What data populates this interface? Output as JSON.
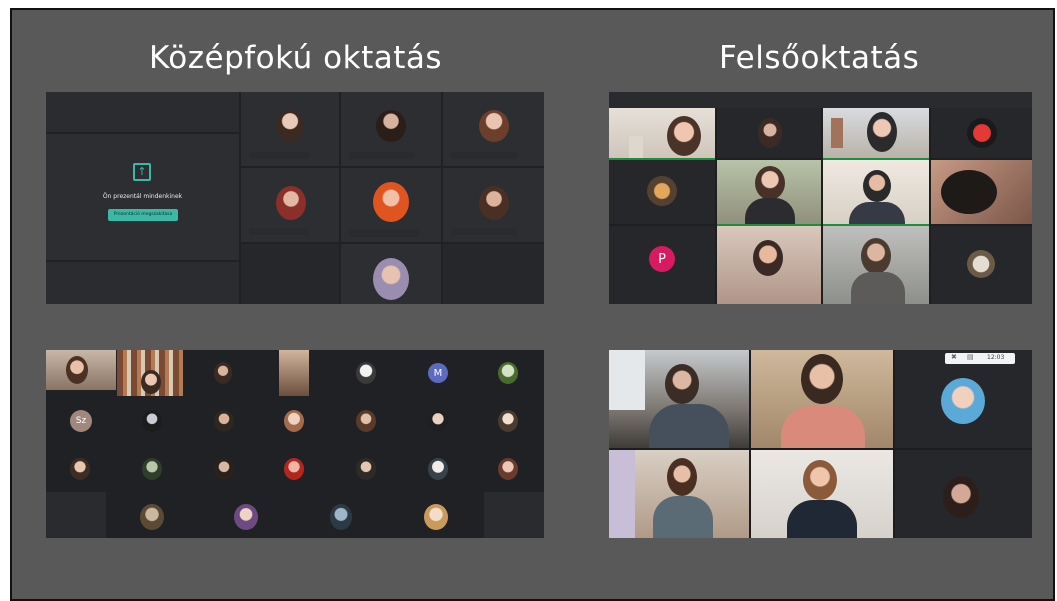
{
  "headings": {
    "left": "Középfokú oktatás",
    "right": "Felsőoktatás"
  },
  "present_box": {
    "icon": "present-screen-icon",
    "title": "Ön prezentál mindenkinek",
    "button": "Prezentáció megszakítása"
  },
  "tile_letters": {
    "m": "M",
    "sz": "Sz",
    "p": "P"
  },
  "status": {
    "time": "12:03"
  },
  "colors": {
    "slide_bg": "#595959",
    "meet_bg": "#202124",
    "tile_bg": "#3c4043",
    "accent_green": "#1e8e3e",
    "button_teal": "#3bb8a6",
    "avatar_m": "#5c6bc0",
    "avatar_sz": "#a1887f",
    "avatar_p": "#d81b60"
  }
}
